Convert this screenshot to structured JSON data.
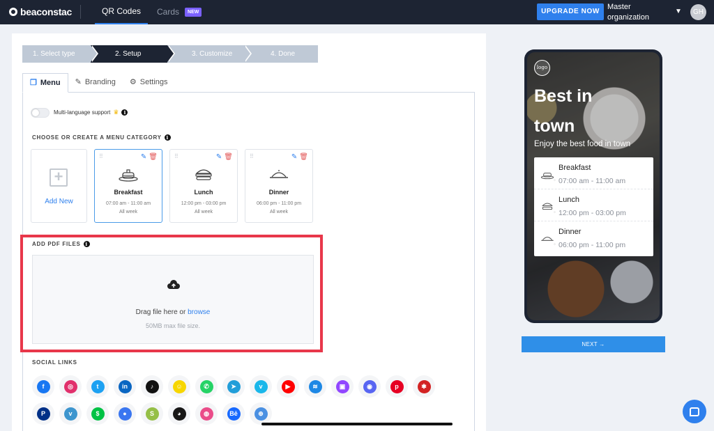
{
  "header": {
    "brand": "beaconstac",
    "nav": {
      "qr_codes": "QR Codes",
      "cards": "Cards",
      "cards_badge": "NEW"
    },
    "upgrade_label": "UPGRADE NOW",
    "org_line1": "Master",
    "org_line2": "organization",
    "avatar_initials": "GH"
  },
  "steps": [
    "1. Select type",
    "2. Setup",
    "3. Customize",
    "4. Done"
  ],
  "active_step": "2. Setup",
  "tabs": {
    "menu": "Menu",
    "branding": "Branding",
    "settings": "Settings"
  },
  "multilanguage_label": "Multi-language support",
  "menu_section_title": "CHOOSE OR CREATE A MENU CATEGORY",
  "add_new_label": "Add New",
  "menu_cards": [
    {
      "name": "Breakfast",
      "time": "07:00 am - 11:00 am",
      "days": "All week",
      "selected": true
    },
    {
      "name": "Lunch",
      "time": "12:00 pm - 03:00 pm",
      "days": "All week",
      "selected": false
    },
    {
      "name": "Dinner",
      "time": "06:00 pm - 11:00 pm",
      "days": "All week",
      "selected": false
    }
  ],
  "pdf_section_title": "ADD PDF FILES",
  "dropzone": {
    "text": "Drag file here or",
    "browse": "browse",
    "sub": "50MB max file size."
  },
  "social_section_title": "SOCIAL LINKS",
  "social_icons": [
    {
      "name": "facebook-icon",
      "glyph": "f",
      "color": "#1877f2"
    },
    {
      "name": "instagram-icon",
      "glyph": "◎",
      "color": "#e1306c"
    },
    {
      "name": "twitter-icon",
      "glyph": "t",
      "color": "#1da1f2"
    },
    {
      "name": "linkedin-icon",
      "glyph": "in",
      "color": "#0a66c2"
    },
    {
      "name": "tiktok-icon",
      "glyph": "♪",
      "color": "#111111"
    },
    {
      "name": "snapchat-icon",
      "glyph": "☺",
      "color": "#f7d600"
    },
    {
      "name": "whatsapp-icon",
      "glyph": "✆",
      "color": "#25d366"
    },
    {
      "name": "telegram-icon",
      "glyph": "➤",
      "color": "#229ed9"
    },
    {
      "name": "vimeo-icon",
      "glyph": "v",
      "color": "#1ab7ea"
    },
    {
      "name": "youtube-icon",
      "glyph": "▶",
      "color": "#ff0000"
    },
    {
      "name": "wechat-icon",
      "glyph": "≋",
      "color": "#1e88e5"
    },
    {
      "name": "twitch-icon",
      "glyph": "▣",
      "color": "#9146ff"
    },
    {
      "name": "discord-icon",
      "glyph": "◉",
      "color": "#5865f2"
    },
    {
      "name": "pinterest-icon",
      "glyph": "p",
      "color": "#e60023"
    },
    {
      "name": "yelp-icon",
      "glyph": "✱",
      "color": "#d32323"
    },
    {
      "name": "paypal-icon",
      "glyph": "P",
      "color": "#003087"
    },
    {
      "name": "venmo-icon",
      "glyph": "v",
      "color": "#3d95ce"
    },
    {
      "name": "cashapp-icon",
      "glyph": "$",
      "color": "#00c244"
    },
    {
      "name": "signal-icon",
      "glyph": "●",
      "color": "#3a76f0"
    },
    {
      "name": "shopify-icon",
      "glyph": "S",
      "color": "#95bf47"
    },
    {
      "name": "github-icon",
      "glyph": "◕",
      "color": "#181717"
    },
    {
      "name": "dribbble-icon",
      "glyph": "◍",
      "color": "#ea4c89"
    },
    {
      "name": "behance-icon",
      "glyph": "Bē",
      "color": "#1769ff"
    },
    {
      "name": "website-icon",
      "glyph": "⊕",
      "color": "#4a90e2"
    }
  ],
  "preview": {
    "logo": "logo",
    "title": "Best in town",
    "subtitle": "Enjoy the best food in town",
    "items": [
      {
        "name": "Breakfast",
        "time": "07:00 am - 11:00 am"
      },
      {
        "name": "Lunch",
        "time": "12:00 pm - 03:00 pm"
      },
      {
        "name": "Dinner",
        "time": "06:00 pm - 11:00 pm"
      }
    ]
  },
  "next_label": "NEXT →",
  "colors": {
    "accent": "#2f80ed",
    "nav_bg": "#1d2433",
    "highlight": "#e8374a"
  }
}
